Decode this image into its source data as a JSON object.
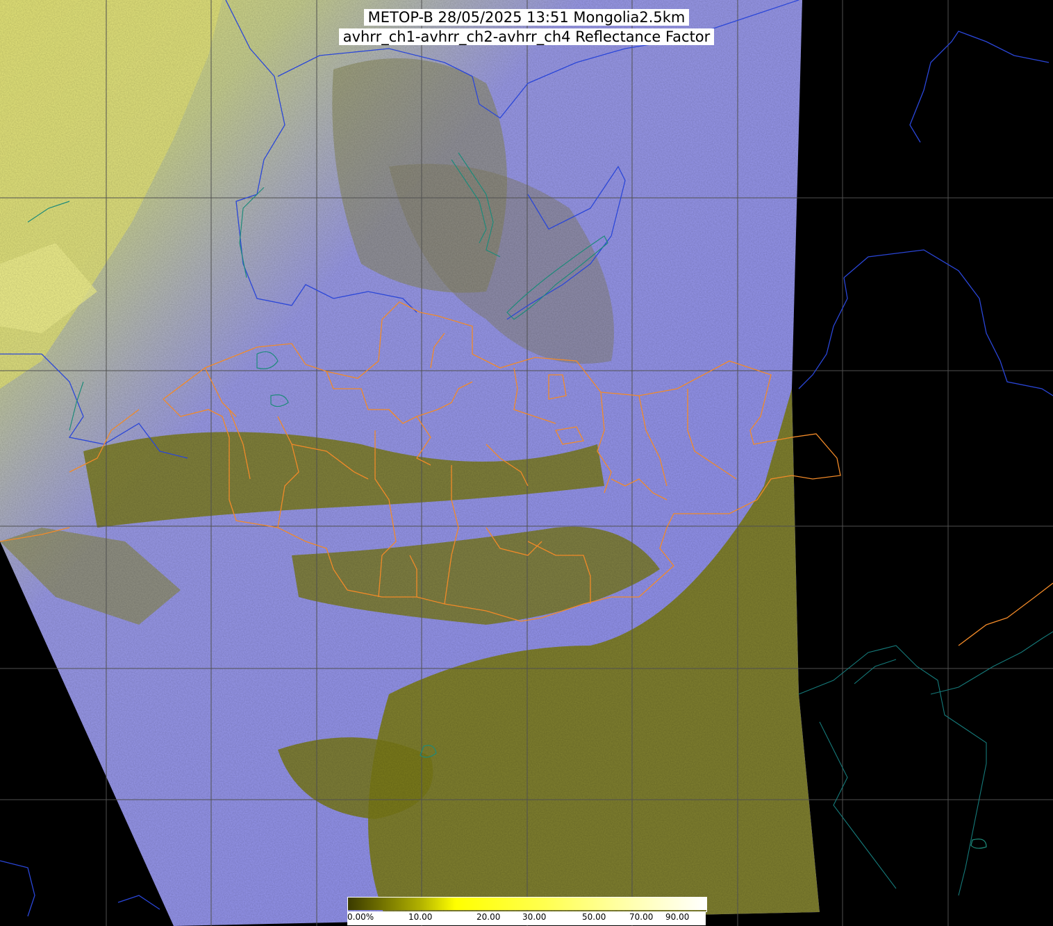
{
  "header": {
    "line1": "METOP-B 28/05/2025 13:51 Mongolia2.5km",
    "line2": "avhrr_ch1-avhrr_ch2-avhrr_ch4 Reflectance Factor"
  },
  "colors": {
    "background": "#000000",
    "cloud": "#8c8cf5",
    "land": "#7a7a18",
    "snow_bright": "#f0f070",
    "grid": "#555555",
    "border_orange": "#f28a28",
    "coast_blue": "#2a46d8",
    "lake_teal": "#1d8a7a"
  },
  "colorbar": {
    "labels": [
      "0.00%",
      "10.00",
      "20.00",
      "30.00",
      "50.00",
      "70.00",
      "90.00"
    ],
    "colors": [
      "#3a3a00",
      "#9a9a00",
      "#ffff00",
      "#ffff40",
      "#ffff90",
      "#ffffd0",
      "#ffffff"
    ]
  }
}
